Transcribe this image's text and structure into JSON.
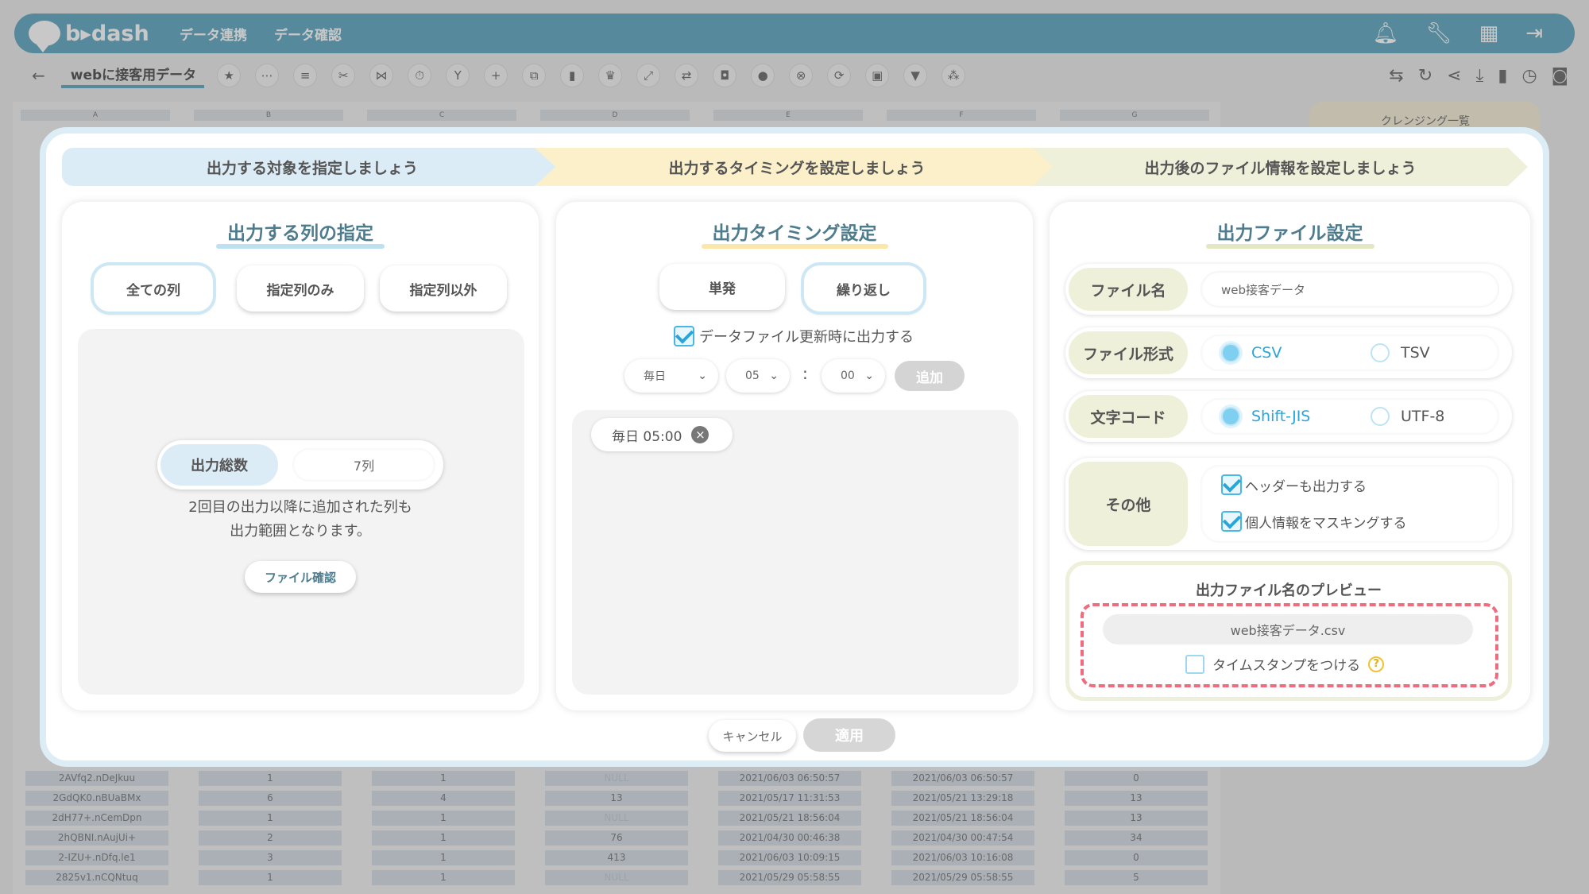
{
  "app": {
    "logo_text": "b▸dash",
    "nav": [
      "データ連携",
      "データ確認"
    ],
    "doc_title": "webに接客用データ",
    "brand_color": "#4a9ab8"
  },
  "sheet": {
    "columns": [
      "A",
      "B",
      "C",
      "D",
      "E",
      "F",
      "G"
    ],
    "cleansing_title": "クレンジング一覧",
    "rows": [
      [
        "2AVfq2.nDeJkuu",
        "1",
        "1",
        "NULL",
        "2021/06/03 06:50:57",
        "2021/06/03 06:50:57",
        "0"
      ],
      [
        "2GdQK0.nBUaBMx",
        "6",
        "4",
        "13",
        "2021/05/17 11:31:53",
        "2021/05/21 13:29:18",
        "13"
      ],
      [
        "2dH77+.nCemDpn",
        "1",
        "1",
        "NULL",
        "2021/05/21 18:56:04",
        "2021/05/21 18:56:04",
        "13"
      ],
      [
        "2hQBNI.nAujUi+",
        "2",
        "1",
        "76",
        "2021/04/30 00:46:38",
        "2021/04/30 00:47:54",
        "34"
      ],
      [
        "2-IZU+.nDfq.le1",
        "3",
        "1",
        "413",
        "2021/06/03 10:09:15",
        "2021/06/03 10:16:08",
        "0"
      ],
      [
        "2825v1.nCQNtuq",
        "1",
        "1",
        "NULL",
        "2021/05/29 05:58:55",
        "2021/05/29 05:58:55",
        "5"
      ]
    ]
  },
  "steps": [
    "出力する対象を指定しましょう",
    "出力するタイミングを設定しましょう",
    "出力後のファイル情報を設定しましょう"
  ],
  "left_panel": {
    "title": "出力する列の指定",
    "buttons": [
      "全ての列",
      "指定列のみ",
      "指定列以外"
    ],
    "count_label": "出力総数",
    "count_value": "7列",
    "note_line1": "2回目の出力以降に追加された列も",
    "note_line2": "出力範囲となります。",
    "file_check": "ファイル確認"
  },
  "mid_panel": {
    "title": "出力タイミング設定",
    "buttons": [
      "単発",
      "繰り返し"
    ],
    "update_checkbox": "データファイル更新時に出力する",
    "freq": "毎日",
    "hour": "05",
    "colon": ":",
    "minute": "00",
    "add": "追加",
    "schedule": "毎日 05:00"
  },
  "right_panel": {
    "title": "出力ファイル設定",
    "filename_label": "ファイル名",
    "filename_value": "web接客データ",
    "format_label": "ファイル形式",
    "format_options": [
      "CSV",
      "TSV"
    ],
    "encoding_label": "文字コード",
    "encoding_options": [
      "Shift-JIS",
      "UTF-8"
    ],
    "other_label": "その他",
    "other_options": [
      "ヘッダーも出力する",
      "個人情報をマスキングする"
    ],
    "preview_title": "出力ファイル名のプレビュー",
    "preview_name": "web接客データ.csv",
    "timestamp_label": "タイムスタンプをつける",
    "help": "?"
  },
  "footer": {
    "cancel": "キャンセル",
    "apply": "適用"
  }
}
